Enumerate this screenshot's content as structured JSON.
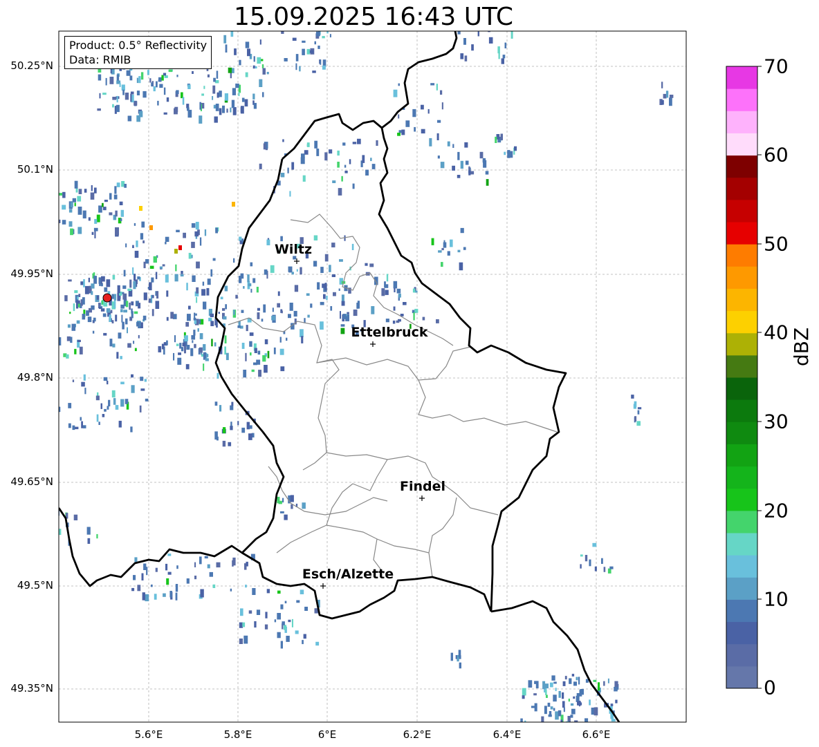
{
  "title": "15.09.2025 16:43 UTC",
  "info": {
    "product": "Product: 0.5° Reflectivity",
    "data": "Data: RMIB"
  },
  "axes": {
    "lat_labels": [
      "50.25°N",
      "50.1°N",
      "49.95°N",
      "49.8°N",
      "49.65°N",
      "49.5°N",
      "49.35°N"
    ],
    "lon_labels": [
      "5.6°E",
      "5.8°E",
      "6°E",
      "6.2°E",
      "6.4°E",
      "6.6°E"
    ]
  },
  "cities": [
    {
      "name": "Wiltz"
    },
    {
      "name": "Ettelbruck"
    },
    {
      "name": "Findel"
    },
    {
      "name": "Esch/Alzette"
    }
  ],
  "colorbar": {
    "label": "dBZ",
    "ticks": [
      "0",
      "10",
      "20",
      "30",
      "40",
      "50",
      "60",
      "70"
    ],
    "colors": [
      "#6577aa",
      "#5a6ca6",
      "#4a62a5",
      "#4c78b2",
      "#5ba0c6",
      "#69c0dc",
      "#66d6c6",
      "#44d46c",
      "#17c41a",
      "#14b41b",
      "#12a313",
      "#0f8a10",
      "#0c7a0d",
      "#0a640b",
      "#457a12",
      "#adb105",
      "#fdd000",
      "#fcb500",
      "#fe9900",
      "#fe7c00",
      "#e60000",
      "#c60000",
      "#a40000",
      "#7e0000",
      "#ffdcfb",
      "#feb2fc",
      "#fd72fa",
      "#e738e4"
    ]
  }
}
